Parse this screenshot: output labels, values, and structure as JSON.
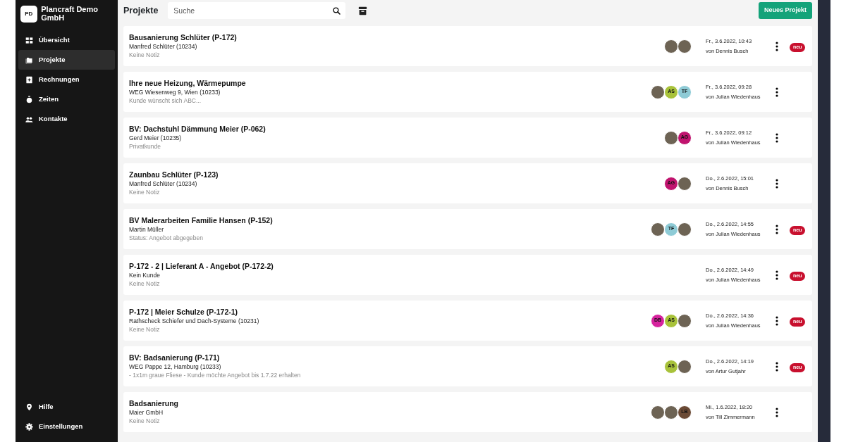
{
  "sidebar": {
    "logo": "PD",
    "company": "Plancraft Demo GmbH",
    "items": [
      {
        "label": "Übersicht",
        "selected": false
      },
      {
        "label": "Projekte",
        "selected": true
      },
      {
        "label": "Rechnungen",
        "selected": false
      },
      {
        "label": "Zeiten",
        "selected": false
      },
      {
        "label": "Kontakte",
        "selected": false
      }
    ],
    "footer_items": [
      {
        "label": "Hilfe"
      },
      {
        "label": "Einstellungen"
      }
    ]
  },
  "header": {
    "title": "Projekte",
    "search": {
      "placeholder": "Suche"
    },
    "new_button": "Neues Projekt"
  },
  "projects": [
    {
      "title": "Bausanierung Schlüter (P-172)",
      "customer": "Manfred Schlüter (10234)",
      "note": "Keine Notiz",
      "avatars": [
        {
          "kind": "photo"
        },
        {
          "kind": "photo"
        }
      ],
      "date": "Fr., 3.6.2022, 10:43",
      "author": "von Dennis Busch",
      "badge": "neu"
    },
    {
      "title": "Ihre neue Heizung, Wärmepumpe",
      "customer": "WEG Wiesenweg 9, Wien (10233)",
      "note": "Kunde wünscht sich ABC...",
      "avatars": [
        {
          "kind": "photo"
        },
        {
          "kind": "initials",
          "text": "AS",
          "color": "#a8c23a"
        },
        {
          "kind": "initials",
          "text": "TF",
          "color": "#8ecbd6"
        }
      ],
      "date": "Fr., 3.6.2022, 09:28",
      "author": "von Julian Wiedenhaus"
    },
    {
      "title": "BV: Dachstuhl Dämmung Meier (P-062)",
      "customer": "Gerd Meier (10235)",
      "note": "Privatkunde",
      "avatars": [
        {
          "kind": "photo"
        },
        {
          "kind": "initials",
          "text": "AG",
          "color": "#c0136e"
        }
      ],
      "date": "Fr., 3.6.2022, 09:12",
      "author": "von Julian Wiedenhaus"
    },
    {
      "title": "Zaunbau Schlüter (P-123)",
      "customer": "Manfred Schlüter (10234)",
      "note": "Keine Notiz",
      "avatars": [
        {
          "kind": "initials",
          "text": "AG",
          "color": "#c0136e"
        },
        {
          "kind": "photo"
        }
      ],
      "date": "Do., 2.6.2022, 15:01",
      "author": "von Dennis Busch"
    },
    {
      "title": "BV Malerarbeiten Familie Hansen (P-152)",
      "customer": "Martin Müller",
      "note": "Status: Angebot abgegeben",
      "avatars": [
        {
          "kind": "photo"
        },
        {
          "kind": "initials",
          "text": "TF",
          "color": "#8ecbd6"
        },
        {
          "kind": "photo"
        }
      ],
      "date": "Do., 2.6.2022, 14:55",
      "author": "von Julian Wiedenhaus",
      "badge": "neu"
    },
    {
      "title": "P-172 - 2 | Lieferant A - Angebot (P-172-2)",
      "customer": "Kein Kunde",
      "note": "Keine Notiz",
      "date": "Do., 2.6.2022, 14:49",
      "author": "von Julian Wiedenhaus",
      "badge": "neu"
    },
    {
      "title": "P-172 | Meier Schulze (P-172-1)",
      "customer": "Rathscheck Schiefer und Dach-Systeme (10231)",
      "note": "Keine Notiz",
      "avatars": [
        {
          "kind": "initials",
          "text": "DB",
          "color": "#d6239e"
        },
        {
          "kind": "initials",
          "text": "AS",
          "color": "#a8c23a"
        },
        {
          "kind": "photo"
        }
      ],
      "date": "Do., 2.6.2022, 14:36",
      "author": "von Julian Wiedenhaus",
      "badge": "neu"
    },
    {
      "title": "BV: Badsanierung (P-171)",
      "customer": "WEG Pappe 12, Hamburg (10233)",
      "note": "- 1x1m graue Fliese - Kunde möchte Angebot bis 1.7.22 erhalten",
      "avatars": [
        {
          "kind": "initials",
          "text": "AS",
          "color": "#a8c23a"
        },
        {
          "kind": "photo"
        }
      ],
      "date": "Do., 2.6.2022, 14:19",
      "author": "von Artur Gutjahr",
      "badge": "neu"
    },
    {
      "title": "Badsanierung",
      "customer": "Maier GmbH",
      "note": "Keine Notiz",
      "avatars": [
        {
          "kind": "photo"
        },
        {
          "kind": "photo"
        },
        {
          "kind": "initials",
          "text": "LB",
          "color": "#6b4a35"
        }
      ],
      "date": "Mi., 1.6.2022, 18:20",
      "author": "von Till Zimmermann"
    }
  ]
}
